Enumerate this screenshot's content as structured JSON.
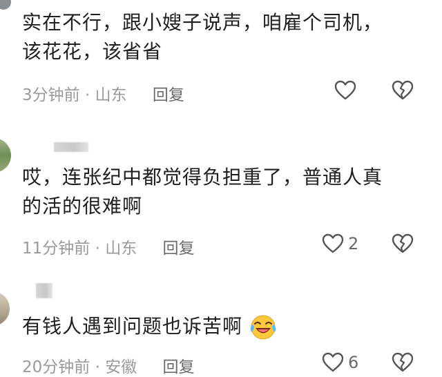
{
  "comments": [
    {
      "text_line1": "实在不行，跟小嫂子说声，咱雇个司机，",
      "text_line2": "该花花，该省省",
      "time": "3分钟前",
      "sep": "·",
      "location": "山东",
      "reply": "回复",
      "likes": ""
    },
    {
      "text_line1": "哎，连张纪中都觉得负担重了，普通人真",
      "text_line2": "的活的很难啊",
      "time": "11分钟前",
      "sep": "·",
      "location": "山东",
      "reply": "回复",
      "likes": "2"
    },
    {
      "text_line1": "有钱人遇到问题也诉苦啊",
      "text_line2": "",
      "time": "20分钟前",
      "sep": "·",
      "location": "安徽",
      "reply": "回复",
      "likes": "6",
      "emoji": "laughing-crying-emoji"
    }
  ],
  "icons": {
    "like": "heart-outline-icon",
    "dislike": "broken-heart-icon"
  },
  "colors": {
    "text": "#1f1f1f",
    "meta": "#9a9a9a",
    "icon": "#555555"
  }
}
